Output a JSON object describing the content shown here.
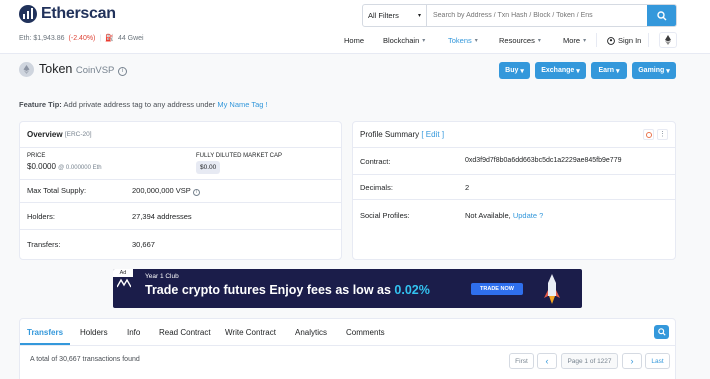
{
  "header": {
    "logo_text": "Etherscan",
    "eth_price": "Eth: $1,943.86",
    "eth_change": "(-2.40%)",
    "gas": "44 Gwei",
    "search_filter": "All Filters",
    "search_placeholder": "Search by Address / Txn Hash / Block / Token / Ens"
  },
  "nav": {
    "home": "Home",
    "blockchain": "Blockchain",
    "tokens": "Tokens",
    "resources": "Resources",
    "more": "More",
    "signin": "Sign In"
  },
  "token": {
    "label": "Token",
    "name": "CoinVSP"
  },
  "action_buttons": [
    "Buy",
    "Exchange",
    "Earn",
    "Gaming"
  ],
  "feature_tip": {
    "prefix": "Feature Tip:",
    "text": "Add private address tag to any address under",
    "link": "My Name Tag !"
  },
  "overview": {
    "title": "Overview",
    "standard": "[ERC-20]",
    "price_label": "PRICE",
    "price_value": "$0.0000",
    "price_eth": "@ 0.000000 Eth",
    "mcap_label": "FULLY DILUTED MARKET CAP",
    "mcap_value": "$0.00",
    "rows": [
      {
        "label": "Max Total Supply:",
        "value": "200,000,000 VSP"
      },
      {
        "label": "Holders:",
        "value": "27,394 addresses"
      },
      {
        "label": "Transfers:",
        "value": "30,667"
      }
    ]
  },
  "profile": {
    "title": "Profile Summary",
    "edit": "[ Edit ]",
    "contract_label": "Contract:",
    "contract_value": "0xd3f9d7f8b0a6dd663bc5dc1a2229ae845fb9e779",
    "decimals_label": "Decimals:",
    "decimals_value": "2",
    "social_label": "Social Profiles:",
    "social_value": "Not Available,",
    "social_link": "Update",
    "social_q": "?"
  },
  "ad": {
    "badge": "Ad",
    "brand": "Year 1 Club",
    "headline": "Trade crypto futures  Enjoy fees as low as",
    "rate": "0.02%",
    "cta": "TRADE NOW"
  },
  "tabs": [
    "Transfers",
    "Holders",
    "Info",
    "Read Contract",
    "Write Contract",
    "Analytics",
    "Comments"
  ],
  "transactions": {
    "summary": "A total of 30,667 transactions found",
    "first": "First",
    "prev": "‹",
    "page": "Page 1 of 1227",
    "next": "›",
    "last": "Last"
  },
  "colors": {
    "accent": "#3498db",
    "brand": "#21325b",
    "down": "#de4437"
  }
}
